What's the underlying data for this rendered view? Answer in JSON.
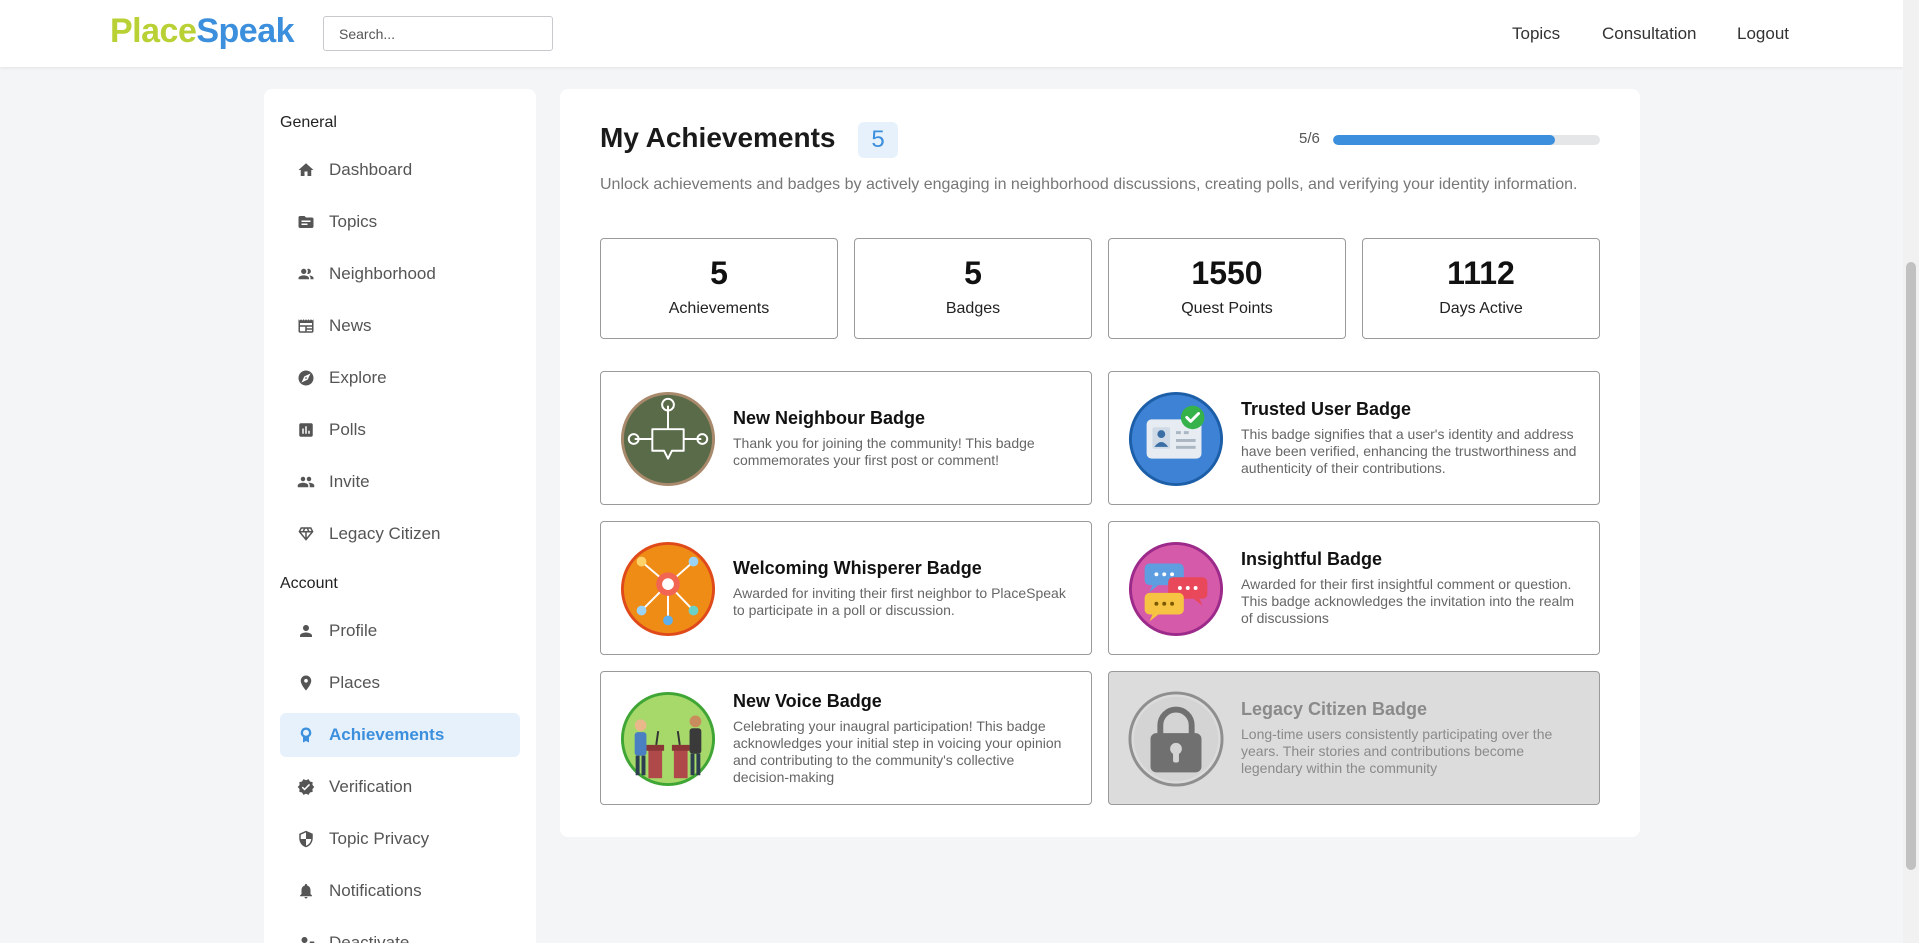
{
  "header": {
    "logo_part1": "Place",
    "logo_part2": "Speak",
    "search_placeholder": "Search...",
    "nav": [
      "Topics",
      "Consultation",
      "Logout"
    ]
  },
  "sidebar": {
    "general_label": "General",
    "general_items": [
      {
        "label": "Dashboard",
        "icon": "home-icon"
      },
      {
        "label": "Topics",
        "icon": "folder-icon"
      },
      {
        "label": "Neighborhood",
        "icon": "people-icon"
      },
      {
        "label": "News",
        "icon": "newspaper-icon"
      },
      {
        "label": "Explore",
        "icon": "compass-icon"
      },
      {
        "label": "Polls",
        "icon": "poll-icon"
      },
      {
        "label": "Invite",
        "icon": "group-icon"
      },
      {
        "label": "Legacy Citizen",
        "icon": "diamond-icon"
      }
    ],
    "account_label": "Account",
    "account_items": [
      {
        "label": "Profile",
        "icon": "person-icon"
      },
      {
        "label": "Places",
        "icon": "location-pin-icon"
      },
      {
        "label": "Achievements",
        "icon": "ribbon-icon",
        "active": true
      },
      {
        "label": "Verification",
        "icon": "verified-icon"
      },
      {
        "label": "Topic Privacy",
        "icon": "shield-icon"
      },
      {
        "label": "Notifications",
        "icon": "bell-icon"
      },
      {
        "label": "Deactivate",
        "icon": "person-remove-icon"
      }
    ]
  },
  "main": {
    "title": "My Achievements",
    "count": "5",
    "progress_label": "5/6",
    "progress_fraction": 0.833,
    "description": "Unlock achievements and badges by actively engaging in neighborhood discussions, creating polls, and verifying your identity information.",
    "stats": [
      {
        "value": "5",
        "label": "Achievements"
      },
      {
        "value": "5",
        "label": "Badges"
      },
      {
        "value": "1550",
        "label": "Quest Points"
      },
      {
        "value": "1112",
        "label": "Days Active"
      }
    ],
    "badges": [
      {
        "title": "New Neighbour Badge",
        "desc": "Thank you for joining the community! This badge commemorates your first post or comment!",
        "icon": "new-neighbour-badge-icon"
      },
      {
        "title": "Trusted User Badge",
        "desc": "This badge signifies that a user's identity and address have been verified, enhancing the trustworthiness and authenticity of their contributions.",
        "icon": "trusted-user-badge-icon"
      },
      {
        "title": "Welcoming Whisperer Badge",
        "desc": "Awarded for inviting their first neighbor to PlaceSpeak to participate in a poll or discussion.",
        "icon": "welcoming-whisperer-badge-icon"
      },
      {
        "title": "Insightful Badge",
        "desc": "Awarded for their first insightful comment or question. This badge acknowledges the invitation into the realm of discussions",
        "icon": "insightful-badge-icon"
      },
      {
        "title": "New Voice Badge",
        "desc": "Celebrating your inaugral participation! This badge acknowledges your initial step in voicing your opinion and contributing to the community's collective decision-making",
        "icon": "new-voice-badge-icon"
      },
      {
        "title": "Legacy Citizen Badge",
        "desc": "Long-time users consistently participating over the years. Their stories and contributions become legendary within the community",
        "icon": "locked-badge-icon",
        "locked": true
      }
    ]
  },
  "colors": {
    "accent": "#3b8fdc",
    "logo_green": "#b9d135",
    "active_bg": "#e6f1fc"
  }
}
